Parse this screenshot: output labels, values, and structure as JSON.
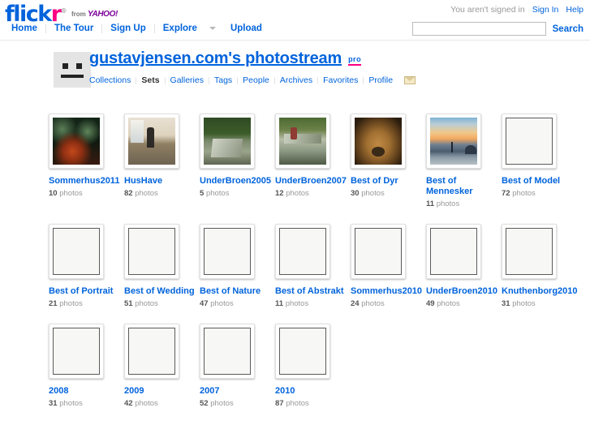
{
  "topbar": {
    "logo": {
      "part1": "flick",
      "part2": "r",
      "registered": "®"
    },
    "from_yahoo": {
      "from": "from",
      "yahoo": "YAHOO!"
    },
    "nav": [
      {
        "label": "Home"
      },
      {
        "label": "The Tour"
      },
      {
        "label": "Sign Up"
      },
      {
        "label": "Explore"
      },
      {
        "label": "Upload"
      }
    ],
    "signed_out_text": "You aren't signed in",
    "sign_in_label": "Sign In",
    "help_label": "Help",
    "search": {
      "value": "",
      "placeholder": "",
      "button_label": "Search"
    },
    "caret_icon": "chevron-down-icon"
  },
  "profile": {
    "avatar_icon": "default-buddy-icon",
    "title": "gustavjensen.com's photostream",
    "pro_badge": "pro",
    "subnav": [
      {
        "label": "Collections",
        "active": false
      },
      {
        "label": "Sets",
        "active": true
      },
      {
        "label": "Galleries",
        "active": false
      },
      {
        "label": "Tags",
        "active": false
      },
      {
        "label": "People",
        "active": false
      },
      {
        "label": "Archives",
        "active": false
      },
      {
        "label": "Favorites",
        "active": false
      },
      {
        "label": "Profile",
        "active": false
      }
    ],
    "mail_icon": "envelope-icon"
  },
  "sets": [
    {
      "title": "Sommerhus2011",
      "count": "10",
      "count_suffix": "photos",
      "art": "art-aquarium",
      "loaded": true
    },
    {
      "title": "HusHave",
      "count": "82",
      "count_suffix": "photos",
      "art": "art-room",
      "loaded": true
    },
    {
      "title": "UnderBroen2005",
      "count": "5",
      "count_suffix": "photos",
      "art": "art-dinner",
      "loaded": true
    },
    {
      "title": "UnderBroen2007",
      "count": "12",
      "count_suffix": "photos",
      "art": "art-dinner2",
      "loaded": true
    },
    {
      "title": "Best of Dyr",
      "count": "30",
      "count_suffix": "photos",
      "art": "art-dog",
      "loaded": true
    },
    {
      "title": "Best of Mennesker",
      "count": "11",
      "count_suffix": "photos",
      "art": "art-beach",
      "loaded": true
    },
    {
      "title": "Best of Model",
      "count": "72",
      "count_suffix": "photos",
      "art": "",
      "loaded": false
    },
    {
      "title": "Best of Portrait",
      "count": "21",
      "count_suffix": "photos",
      "art": "",
      "loaded": false
    },
    {
      "title": "Best of Wedding",
      "count": "51",
      "count_suffix": "photos",
      "art": "",
      "loaded": false
    },
    {
      "title": "Best of Nature",
      "count": "47",
      "count_suffix": "photos",
      "art": "",
      "loaded": false
    },
    {
      "title": "Best of Abstrakt",
      "count": "11",
      "count_suffix": "photos",
      "art": "",
      "loaded": false
    },
    {
      "title": "Sommerhus2010",
      "count": "24",
      "count_suffix": "photos",
      "art": "",
      "loaded": false
    },
    {
      "title": "UnderBroen2010",
      "count": "49",
      "count_suffix": "photos",
      "art": "",
      "loaded": false
    },
    {
      "title": "Knuthenborg2010",
      "count": "31",
      "count_suffix": "photos",
      "art": "",
      "loaded": false
    },
    {
      "title": "2008",
      "count": "31",
      "count_suffix": "photos",
      "art": "",
      "loaded": false
    },
    {
      "title": "2009",
      "count": "42",
      "count_suffix": "photos",
      "art": "",
      "loaded": false
    },
    {
      "title": "2007",
      "count": "52",
      "count_suffix": "photos",
      "art": "",
      "loaded": false
    },
    {
      "title": "2010",
      "count": "87",
      "count_suffix": "photos",
      "art": "",
      "loaded": false
    }
  ],
  "colors": {
    "link_blue": "#0063DC",
    "brand_pink": "#FF0084",
    "yahoo_purple": "#7B0099"
  }
}
